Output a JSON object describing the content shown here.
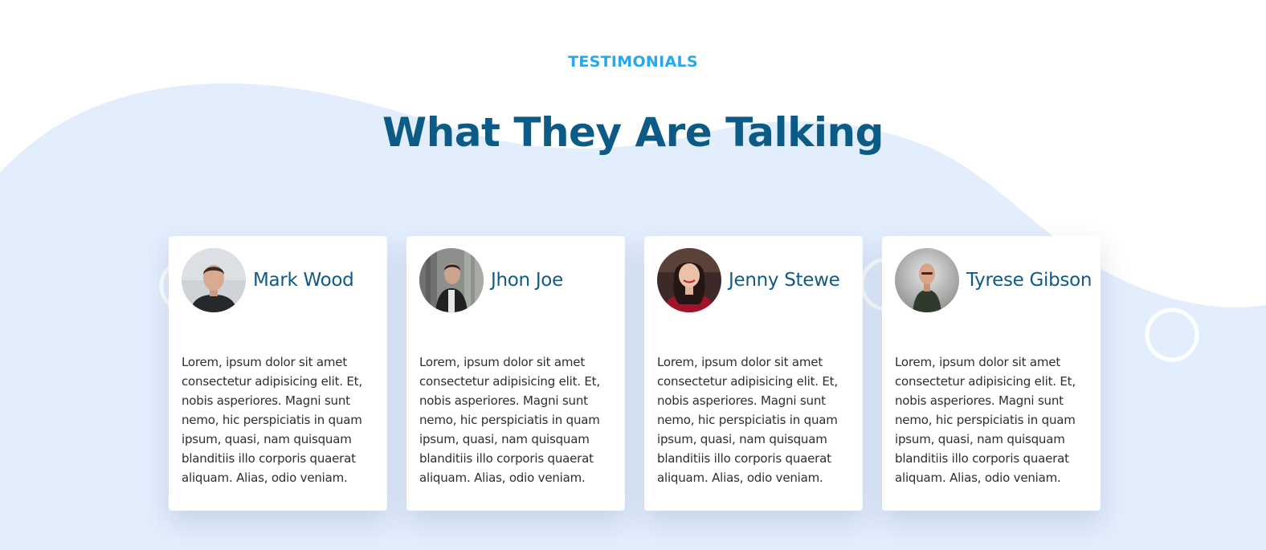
{
  "section": {
    "eyebrow": "TESTIMONIALS",
    "heading": "What They Are Talking"
  },
  "colors": {
    "accent": "#27a8ea",
    "heading": "#0c5b87",
    "wave": "#e3eefd"
  },
  "testimonials": [
    {
      "name": "Mark Wood",
      "avatar": "avatar-mark-wood",
      "quote": "Lorem, ipsum dolor sit amet consectetur adipisicing elit. Et, nobis asperiores. Magni sunt nemo, hic perspiciatis in quam ipsum, quasi, nam quisquam blanditiis illo corporis quaerat aliquam. Alias, odio veniam."
    },
    {
      "name": "Jhon Joe",
      "avatar": "avatar-jhon-joe",
      "quote": "Lorem, ipsum dolor sit amet consectetur adipisicing elit. Et, nobis asperiores. Magni sunt nemo, hic perspiciatis in quam ipsum, quasi, nam quisquam blanditiis illo corporis quaerat aliquam. Alias, odio veniam."
    },
    {
      "name": "Jenny Stewe",
      "avatar": "avatar-jenny-stewe",
      "quote": "Lorem, ipsum dolor sit amet consectetur adipisicing elit. Et, nobis asperiores. Magni sunt nemo, hic perspiciatis in quam ipsum, quasi, nam quisquam blanditiis illo corporis quaerat aliquam. Alias, odio veniam."
    },
    {
      "name": "Tyrese Gibson",
      "avatar": "avatar-tyrese-gibson",
      "quote": "Lorem, ipsum dolor sit amet consectetur adipisicing elit. Et, nobis asperiores. Magni sunt nemo, hic perspiciatis in quam ipsum, quasi, nam quisquam blanditiis illo corporis quaerat aliquam. Alias, odio veniam."
    }
  ]
}
